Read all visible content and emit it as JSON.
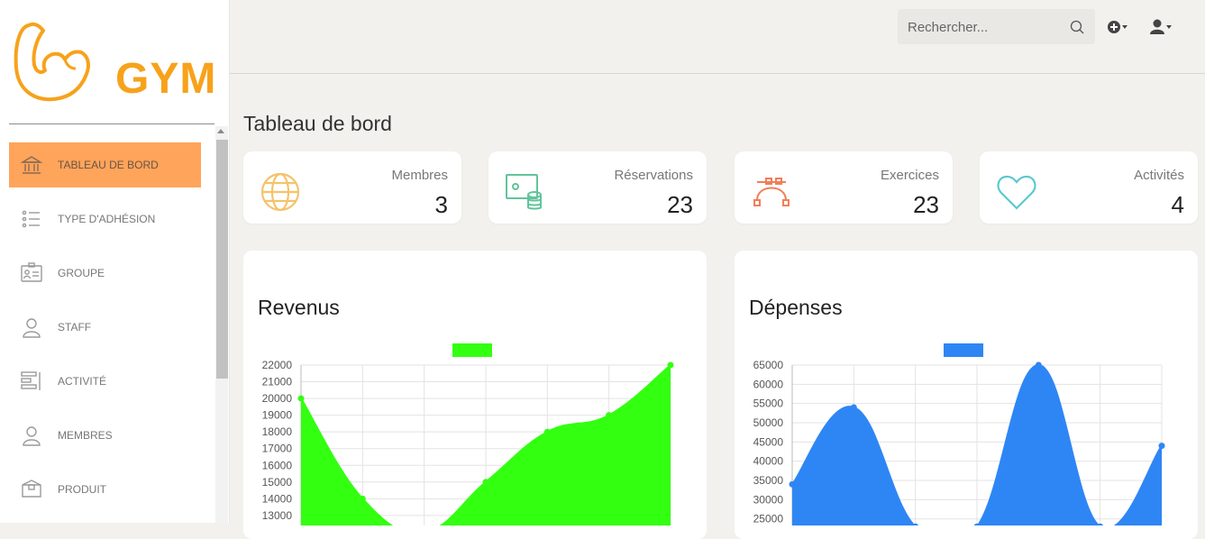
{
  "brand": {
    "text": "GYM",
    "color": "#f7a21b"
  },
  "sidebar": {
    "items": [
      {
        "label": "TABLEAU DE BORD",
        "icon": "bank-icon",
        "active": true
      },
      {
        "label": "TYPE D'ADHÉSION",
        "icon": "list-icon",
        "active": false
      },
      {
        "label": "GROUPE",
        "icon": "id-card-icon",
        "active": false
      },
      {
        "label": "STAFF",
        "icon": "user-icon",
        "active": false
      },
      {
        "label": "ACTIVITÉ",
        "icon": "bars-icon",
        "active": false
      },
      {
        "label": "MEMBRES",
        "icon": "user-icon",
        "active": false
      },
      {
        "label": "PRODUIT",
        "icon": "box-icon",
        "active": false
      }
    ]
  },
  "topbar": {
    "search_placeholder": "Rechercher...",
    "icons": [
      "search-icon",
      "plus-circle-icon",
      "user-dropdown-icon"
    ]
  },
  "main": {
    "title": "Tableau de bord",
    "stats": [
      {
        "label": "Membres",
        "value": "3",
        "icon": "globe-icon",
        "color": "#f5c36a"
      },
      {
        "label": "Réservations",
        "value": "23",
        "icon": "money-coins-icon",
        "color": "#62c49a"
      },
      {
        "label": "Exercices",
        "value": "23",
        "icon": "vector-curve-icon",
        "color": "#ef7f5a"
      },
      {
        "label": "Activités",
        "value": "4",
        "icon": "heart-icon",
        "color": "#5bc8cf"
      }
    ]
  },
  "chart_data": [
    {
      "type": "area",
      "title": "Revenus",
      "color": "#33ff11",
      "y_ticks": [
        13000,
        14000,
        15000,
        16000,
        17000,
        18000,
        19000,
        20000,
        21000,
        22000
      ],
      "ylim": [
        12400,
        22000
      ],
      "x": [
        0,
        1,
        2,
        3,
        4,
        5,
        6
      ],
      "values": [
        20000,
        14000,
        12000,
        15000,
        18000,
        19000,
        22000
      ],
      "grid": true
    },
    {
      "type": "area",
      "title": "Dépenses",
      "color": "#2e86f5",
      "y_ticks": [
        25000,
        30000,
        35000,
        40000,
        45000,
        50000,
        55000,
        60000,
        65000
      ],
      "ylim": [
        23300,
        65000
      ],
      "x": [
        0,
        1,
        2,
        3,
        4,
        5,
        6
      ],
      "values": [
        34000,
        54000,
        23000,
        23000,
        65000,
        23000,
        44000
      ],
      "grid": true
    }
  ]
}
